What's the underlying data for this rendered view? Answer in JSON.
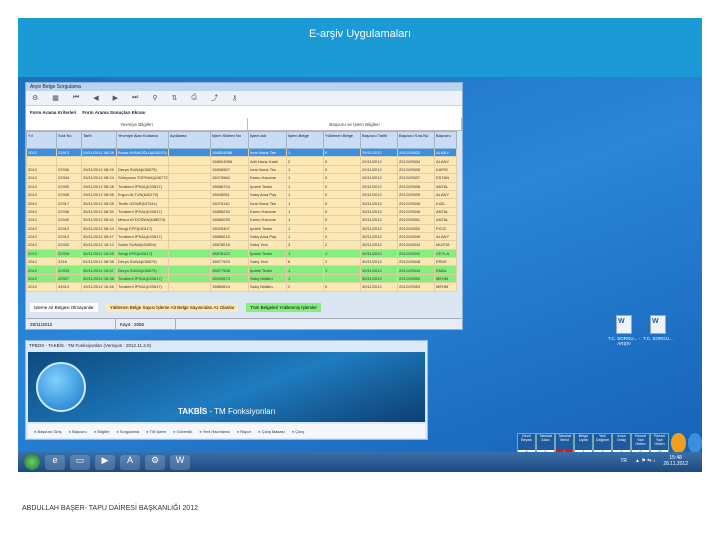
{
  "slide": {
    "title": "E-arşiv Uygulamaları",
    "footer": "ABDULLAH BAŞER- TAPU DAİRESİ BAŞKANLIĞI 2012"
  },
  "window": {
    "title": "Arşiv Belge Sorgulama",
    "tabs": [
      "Form Arama Kriterleri",
      "Form Arama Sonuçları Ekranı"
    ],
    "groups": [
      "Yevmiye Bilgileri",
      "Başvuru ve İşlem Bilgileri"
    ],
    "columns": [
      "Yıl",
      "Sıra No",
      "Tarih",
      "Yevmiye Alan Kullanıcı",
      "Açıklama",
      "İşlem Sistem No",
      "İşlem Adı",
      "İşlem Belge",
      "Yüklenen Belge",
      "Başvuru Tarihi",
      "Başvuru Sıra No",
      "Başvuru"
    ],
    "rows": [
      {
        "s": "s",
        "c": [
          "2012",
          "22913",
          "29/11/2012 08:28",
          "Burak AYANOĞLU(k35223)",
          "",
          "158524958",
          "İcrai Haciz Tes",
          "1",
          "0",
          "29/11/2012",
          "2012/29522",
          "ALANY"
        ]
      },
      {
        "s": "y",
        "c": [
          "",
          "",
          "",
          "",
          "",
          "158524958",
          "Adli Haciz Kaldı",
          "2",
          "0",
          "29/11/2012",
          "2012/29534",
          "ALANY"
        ]
      },
      {
        "s": "y",
        "c": [
          "2012",
          "22936",
          "29/11/2012 08:29",
          "Derya SUNA(k38579)",
          "",
          "15836557",
          "İcrai Haciz Tes",
          "1",
          "0",
          "29/11/2012",
          "2012/29535",
          "KAPIS"
        ]
      },
      {
        "s": "y",
        "c": [
          "2012",
          "22934",
          "29/11/2012 08:24",
          "Süleyman TOPRAK(k38772)",
          "",
          "15079560",
          "Kamu Haczine",
          "1",
          "0",
          "29/11/2012",
          "2012/29537",
          "ESTAN"
        ]
      },
      {
        "s": "y",
        "c": [
          "2012",
          "22930",
          "29/11/2012 08:28",
          "Turabeni İPSAL(k33617)",
          "",
          "15686724",
          "İpotek Tesisi",
          "1",
          "0",
          "29/11/2012",
          "2012/29538",
          "ANTAL"
        ]
      },
      {
        "s": "y",
        "c": [
          "2012",
          "22945",
          "29/11/2012 08:58",
          "Ergun ALTUN(k32279)",
          "",
          "15635051",
          "Satış Arsa Pay",
          "1",
          "0",
          "29/11/2012",
          "2012/29539",
          "ALANY"
        ]
      },
      {
        "s": "y",
        "c": [
          "2012",
          "22917",
          "30/11/2012 08:08",
          "Tevfik IZGAR(k37611)",
          "",
          "15075110",
          "İcrai Haciz Tes",
          "1",
          "0",
          "30/11/2012",
          "2012/29545",
          "KIZIL"
        ]
      },
      {
        "s": "y",
        "c": [
          "2012",
          "22938",
          "30/11/2012 08:30",
          "Turabeni İPSAL(k33617)",
          "",
          "15885230",
          "Kamu Haczine",
          "1",
          "0",
          "30/11/2012",
          "2012/29546",
          "ANTAL"
        ]
      },
      {
        "s": "y",
        "c": [
          "2012",
          "22940",
          "30/11/2012 08:40",
          "Mesut AYDOĞAN(k38573)",
          "",
          "15885035",
          "Kamu Haczine",
          "1",
          "0",
          "30/11/2012",
          "2012/29551",
          "ANTAL"
        ]
      },
      {
        "s": "y",
        "c": [
          "2012",
          "22912",
          "30/11/2012 08:44",
          "Sevgi EFE(k30117)",
          "",
          "15025407",
          "İpotek Tesisi",
          "1",
          "0",
          "30/11/2012",
          "2012/29552",
          "FICIZ"
        ]
      },
      {
        "s": "y",
        "c": [
          "2012",
          "22913",
          "30/11/2012 08:47",
          "Turabeni İPSAL(k33617)",
          "",
          "15885015",
          "Satış Arsa Pay",
          "1",
          "0",
          "30/11/2012",
          "2012/29549",
          "ALANY"
        ]
      },
      {
        "s": "y",
        "c": [
          "2012",
          "22932",
          "30/11/2012 15:12",
          "Salim SUNA(k32894)",
          "",
          "15878018",
          "Satış Yeni",
          "3",
          "2",
          "30/11/2012",
          "2012/29543",
          "MUSTA"
        ]
      },
      {
        "s": "g",
        "c": [
          "2012",
          "22934",
          "30/11/2012 15:29",
          "Sevgi EFE(k30117)",
          "",
          "15878122",
          "İpotek Tesisi",
          "1",
          "1",
          "30/11/2012",
          "2012/29542",
          "CEYLA"
        ]
      },
      {
        "s": "y",
        "c": [
          "2012",
          "3316",
          "02/11/2012 08:38",
          "Derya SUNA(k38579)",
          "",
          "15877929",
          "Satış Yeni",
          "6",
          "2",
          "30/11/2012",
          "2012/29548",
          "ERKE"
        ]
      },
      {
        "s": "g",
        "c": [
          "2012",
          "22933",
          "30/11/2012 15:57",
          "Derya SUNA(k38579)",
          "",
          "15877908",
          "İpotek Tesisi",
          "1",
          "1",
          "30/11/2012",
          "2012/29544",
          "EMAL"
        ]
      },
      {
        "s": "g",
        "c": [
          "2012",
          "22907",
          "30/11/2012 15:38",
          "Turabeni İPSAL(k33617)",
          "",
          "15000673",
          "Satış Malikin",
          "1",
          "",
          "30/11/2012",
          "2012/29550",
          "MEHM"
        ]
      },
      {
        "s": "y",
        "c": [
          "2012",
          "34513",
          "19/11/2012 10:46",
          "Turabeni İPSAL(k33617)",
          "",
          "15889814",
          "Satış Malikin",
          "2",
          "0",
          "30/11/2012",
          "2012/29553",
          "MEHM"
        ]
      }
    ],
    "legend": [
      "İşleme Ait Belgesi Olmayanlar",
      "Yüklenen Belge Sayısı İşleme Ait Belge Sayısından Az Olanlar",
      "Tüm Belgeleri Yüklenmiş İşlemler"
    ],
    "legend_colors": [
      "#ffffff",
      "#fde7b4",
      "#86ee7c"
    ],
    "status": {
      "date": "28/11/2012",
      "count": "Kayıt : 2065"
    }
  },
  "takbis": {
    "title": "TPBOX - TAKBİS - TM Fonksiyonları (Versiyon : 2012.11.2.0)",
    "brand": "TAKBİS",
    "subtitle": "- TM Fonksiyonları",
    "buttons": [
      "Başvuru Giriş",
      "Başvuru",
      "Bilgiler",
      "Sorgulama",
      "TM İşlem",
      "Güvenlik",
      "Yeni Hazırlama",
      "Rapor",
      "Çıkış Masası",
      "Çıkış"
    ]
  },
  "desktop": {
    "icons": [
      "T.C. SORGU... - ARŞİV",
      "T.C. SORGU..."
    ]
  },
  "widget": {
    "cols": [
      {
        "h": "Devir Beyan",
        "v": "6"
      },
      {
        "h": "Tahsilat Alacı",
        "v": "0"
      },
      {
        "h": "Tahsilat Verici",
        "v": "1",
        "red": true
      },
      {
        "h": "Belge Uyarı",
        "v": "1"
      },
      {
        "h": "Yeni Dağıtım",
        "v": "0"
      },
      {
        "h": "İmza Onay",
        "v": "0"
      },
      {
        "h": "Resmi Yazı Gelen",
        "v": "0"
      },
      {
        "h": "Resmi Yazı Giden",
        "v": "15"
      }
    ]
  },
  "tray": {
    "lang": "TR",
    "time": "15:48",
    "date": "28.11.2012"
  }
}
